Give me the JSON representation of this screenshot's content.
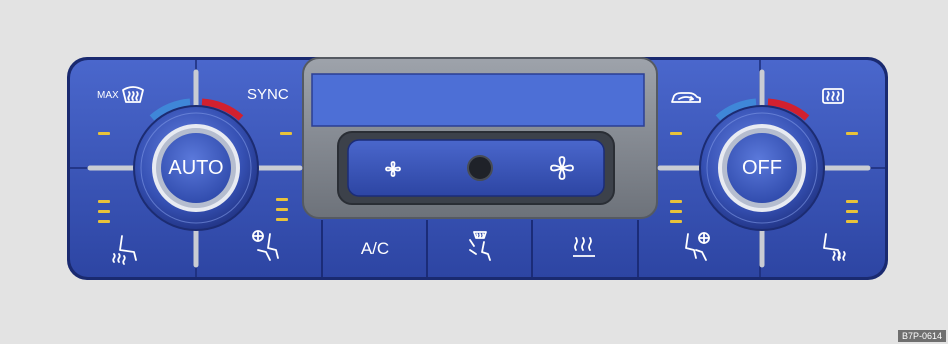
{
  "panel": {
    "left_dial": {
      "label": "AUTO"
    },
    "right_dial": {
      "label": "OFF"
    },
    "top_left": {
      "max_label": "MAX",
      "sync_label": "SYNC"
    },
    "center_buttons": {
      "ac_label": "A/C"
    },
    "display": {
      "text": ""
    }
  },
  "figure": {
    "code": "B7P-0614"
  },
  "colors": {
    "panel_blue": "#3a55b8",
    "panel_dark": "#1b2c78",
    "display_blue": "#4d6fd6",
    "indicator_amber": "#e8c23a",
    "hot_red": "#d2202f",
    "cold_blue": "#3f87d8"
  },
  "icons": [
    "front-defrost-icon",
    "rear-defrost-icon",
    "recirculation-car-icon",
    "fan-small-icon",
    "fan-large-icon",
    "heated-seat-left-icon",
    "heated-seat-right-icon",
    "ventilated-seat-left-icon",
    "ventilated-seat-right-icon",
    "seat-airflow-icon",
    "footwell-heat-icon"
  ]
}
